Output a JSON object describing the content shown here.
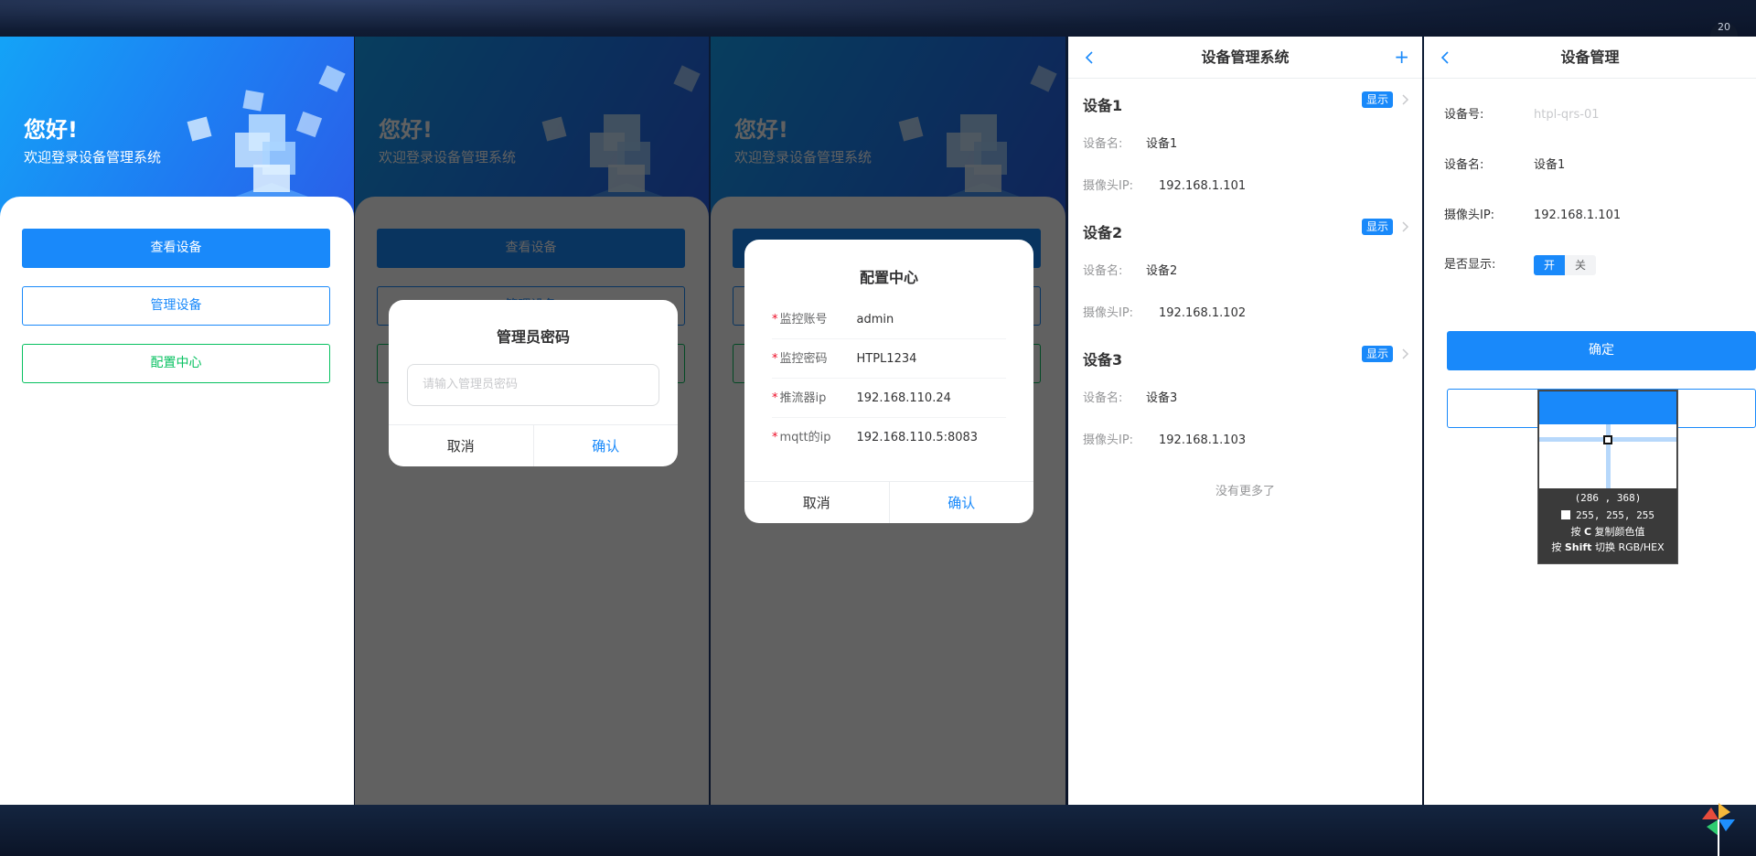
{
  "topbar": {
    "badge": "20"
  },
  "login": {
    "hello": "您好!",
    "welcome": "欢迎登录设备管理系统",
    "btn_view": "查看设备",
    "btn_manage": "管理设备",
    "btn_config": "配置中心"
  },
  "admin_dialog": {
    "title": "管理员密码",
    "placeholder": "请输入管理员密码",
    "cancel": "取消",
    "confirm": "确认"
  },
  "config_dialog": {
    "title": "配置中心",
    "fields": [
      {
        "required": "*",
        "label": "监控账号",
        "value": "admin"
      },
      {
        "required": "*",
        "label": "监控密码",
        "value": "HTPL1234"
      },
      {
        "required": "*",
        "label": "推流器ip",
        "value": "192.168.110.24"
      },
      {
        "required": "*",
        "label": "mqtt的ip",
        "value": "192.168.110.5:8083"
      }
    ],
    "cancel": "取消",
    "confirm": "确认"
  },
  "device_list": {
    "title": "设备管理系统",
    "add_icon": "+",
    "name_key": "设备名:",
    "ip_key": "摄像头IP:",
    "devices": [
      {
        "title": "设备1",
        "tag": "显示",
        "name": "设备1",
        "ip": "192.168.1.101"
      },
      {
        "title": "设备2",
        "tag": "显示",
        "name": "设备2",
        "ip": "192.168.1.102"
      },
      {
        "title": "设备3",
        "tag": "显示",
        "name": "设备3",
        "ip": "192.168.1.103"
      }
    ],
    "no_more": "没有更多了"
  },
  "device_detail": {
    "title": "设备管理",
    "id_label": "设备号:",
    "id_placeholder": "htpl-qrs-01",
    "name_label": "设备名:",
    "name_value": "设备1",
    "ip_label": "摄像头IP:",
    "ip_value": "192.168.1.101",
    "show_label": "是否显示:",
    "switch_on": "开",
    "switch_off": "关",
    "ok": "确定"
  },
  "color_picker": {
    "coords": "(286 , 368)",
    "rgb": "255, 255, 255",
    "hint_copy_pre": "按 ",
    "hint_copy_key": "C",
    "hint_copy_post": " 复制颜色值",
    "hint_switch_pre": "按 ",
    "hint_switch_key": "Shift",
    "hint_switch_post": " 切换 RGB/HEX"
  },
  "colors": {
    "primary": "#1989fa",
    "success": "#07c160",
    "danger": "#ee0a24",
    "hero_start": "#14a3f7",
    "hero_end": "#2a5fe8"
  }
}
